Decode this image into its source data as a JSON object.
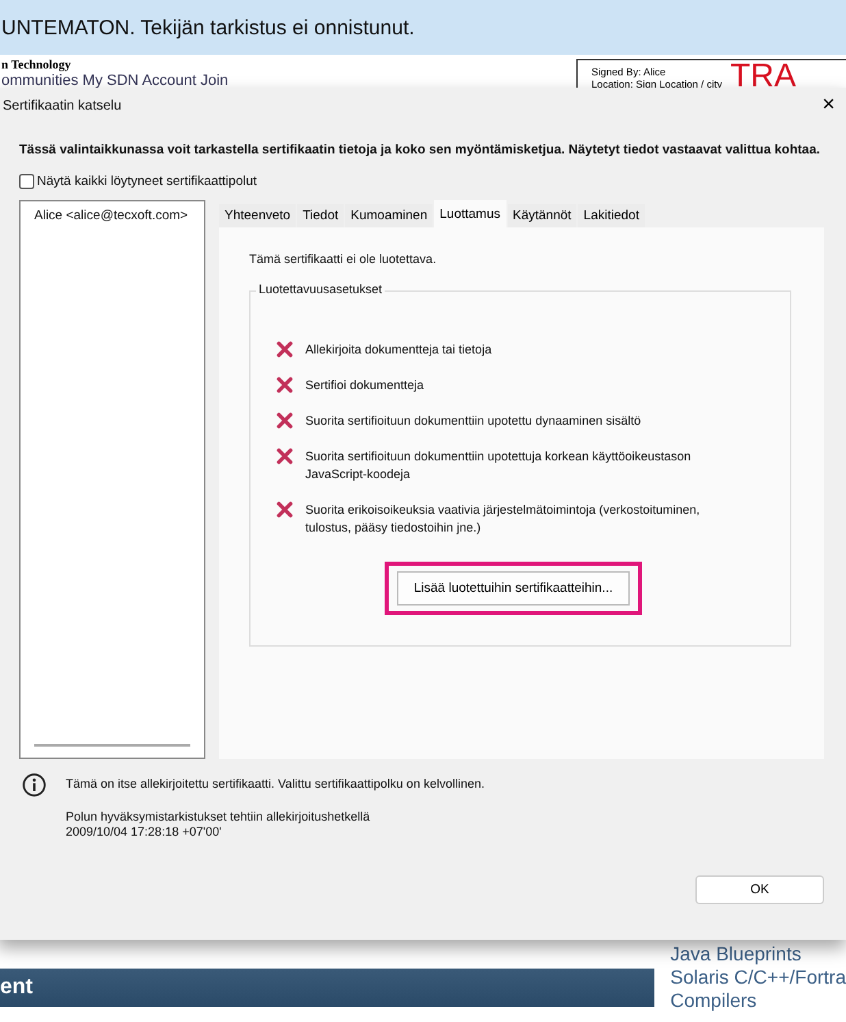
{
  "notification_bar": {
    "text": "UNTEMATON. Tekijän tarkistus ei onnistunut."
  },
  "background_page": {
    "site_name": "n Technology",
    "nav_links": "ommunities My SDN Account  Join",
    "signature_box": {
      "signed_by": "Signed By: Alice",
      "location": "Location: Sign Location / city",
      "stamp": "TRA"
    },
    "section_header": "ent",
    "sidebar_links": [
      "Java Blueprints",
      "Solaris C/C++/Fortra",
      "Compilers"
    ]
  },
  "dialog": {
    "title": "Sertifikaatin katselu",
    "close": "×",
    "description": "Tässä valintaikkunassa voit tarkastella sertifikaatin tietoja ja koko sen myöntämisketjua. Näytetyt tiedot vastaavat valittua kohtaa.",
    "show_all_paths": {
      "label": "Näytä kaikki löytyneet sertifikaattipolut",
      "checked": false
    },
    "certificate_tree": [
      {
        "label": "Alice <alice@tecxoft.com>",
        "selected": false
      }
    ],
    "tabs": [
      {
        "label": "Yhteenveto",
        "selected": false
      },
      {
        "label": "Tiedot",
        "selected": false
      },
      {
        "label": "Kumoaminen",
        "selected": false
      },
      {
        "label": "Luottamus",
        "selected": true
      },
      {
        "label": "Käytännöt",
        "selected": false
      },
      {
        "label": "Lakitiedot",
        "selected": false
      }
    ],
    "trust_status": "Tämä sertifikaatti ei ole luotettava.",
    "trust_settings": {
      "title": "Luotettavuusasetukset",
      "items": [
        {
          "text": "Allekirjoita dokumentteja tai tietoja",
          "allowed": false
        },
        {
          "text": "Sertifioi dokumentteja",
          "allowed": false
        },
        {
          "text": "Suorita sertifioituun dokumenttiin upotettu dynaaminen sisältö",
          "allowed": false
        },
        {
          "text": "Suorita sertifioituun dokumenttiin upotettuja korkean käyttöoikeustason JavaScript-koodeja",
          "allowed": false
        },
        {
          "text": "Suorita erikoisoikeuksia vaativia järjestelmätoimintoja (verkostoituminen, tulostus, pääsy tiedostoihin jne.)",
          "allowed": false
        }
      ],
      "add_button": {
        "label": "Lisää luotettuihin sertifikaatteihin...",
        "highlighted": true
      }
    },
    "info": {
      "message": "Tämä on itse allekirjoitettu sertifikaatti. Valittu sertifikaattipolku on kelvollinen.",
      "validation_note": "Polun hyväksymistarkistukset tehtiin allekirjoitushetkellä",
      "timestamp": "2009/10/04 17:28:18 +07'00'"
    },
    "ok_button": "OK"
  }
}
